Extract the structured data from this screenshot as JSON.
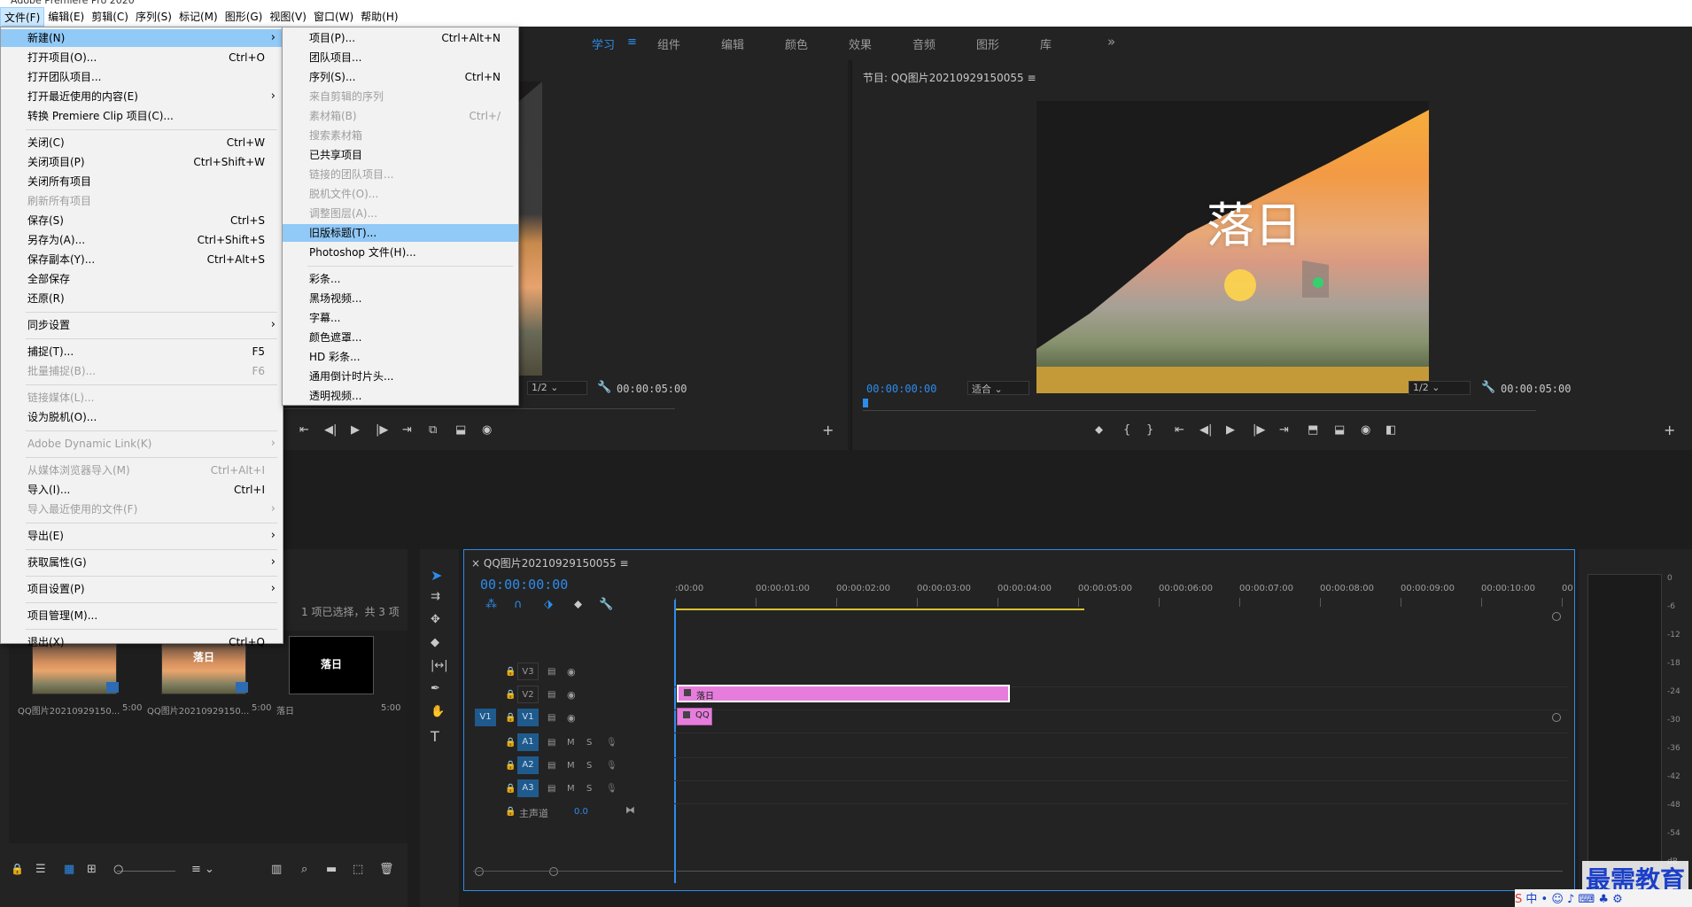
{
  "menubar": {
    "items": [
      "文件(F)",
      "编辑(E)",
      "剪辑(C)",
      "序列(S)",
      "标记(M)",
      "图形(G)",
      "视图(V)",
      "窗口(W)",
      "帮助(H)"
    ]
  },
  "workspaces": [
    "学习",
    "组件",
    "编辑",
    "颜色",
    "效果",
    "音频",
    "图形",
    "库"
  ],
  "workspace_more": "»",
  "file_menu": [
    {
      "label": "新建(N)",
      "shortcut": "",
      "sub": true,
      "state": "highlighted"
    },
    {
      "label": "打开项目(O)...",
      "shortcut": "Ctrl+O"
    },
    {
      "label": "打开团队项目..."
    },
    {
      "label": "打开最近使用的内容(E)",
      "sub": true
    },
    {
      "label": "转换 Premiere Clip 项目(C)..."
    },
    {
      "sep": true
    },
    {
      "label": "关闭(C)",
      "shortcut": "Ctrl+W"
    },
    {
      "label": "关闭项目(P)",
      "shortcut": "Ctrl+Shift+W"
    },
    {
      "label": "关闭所有项目"
    },
    {
      "label": "刷新所有项目",
      "state": "disabled"
    },
    {
      "label": "保存(S)",
      "shortcut": "Ctrl+S"
    },
    {
      "label": "另存为(A)...",
      "shortcut": "Ctrl+Shift+S"
    },
    {
      "label": "保存副本(Y)...",
      "shortcut": "Ctrl+Alt+S"
    },
    {
      "label": "全部保存"
    },
    {
      "label": "还原(R)"
    },
    {
      "sep": true
    },
    {
      "label": "同步设置",
      "sub": true
    },
    {
      "sep": true
    },
    {
      "label": "捕捉(T)...",
      "shortcut": "F5"
    },
    {
      "label": "批量捕捉(B)...",
      "shortcut": "F6",
      "state": "disabled"
    },
    {
      "sep": true
    },
    {
      "label": "链接媒体(L)...",
      "state": "disabled"
    },
    {
      "label": "设为脱机(O)..."
    },
    {
      "sep": true
    },
    {
      "label": "Adobe Dynamic Link(K)",
      "sub": true,
      "state": "disabled"
    },
    {
      "sep": true
    },
    {
      "label": "从媒体浏览器导入(M)",
      "shortcut": "Ctrl+Alt+I",
      "state": "disabled"
    },
    {
      "label": "导入(I)...",
      "shortcut": "Ctrl+I"
    },
    {
      "label": "导入最近使用的文件(F)",
      "sub": true,
      "state": "disabled"
    },
    {
      "sep": true
    },
    {
      "label": "导出(E)",
      "sub": true
    },
    {
      "sep": true
    },
    {
      "label": "获取属性(G)",
      "sub": true
    },
    {
      "sep": true
    },
    {
      "label": "项目设置(P)",
      "sub": true
    },
    {
      "sep": true
    },
    {
      "label": "项目管理(M)..."
    },
    {
      "sep": true
    },
    {
      "label": "退出(X)",
      "shortcut": "Ctrl+Q"
    }
  ],
  "new_submenu": [
    {
      "label": "项目(P)...",
      "shortcut": "Ctrl+Alt+N"
    },
    {
      "label": "团队项目..."
    },
    {
      "label": "序列(S)...",
      "shortcut": "Ctrl+N"
    },
    {
      "label": "来自剪辑的序列",
      "state": "disabled"
    },
    {
      "label": "素材箱(B)",
      "shortcut": "Ctrl+/",
      "state": "disabled"
    },
    {
      "label": "搜索素材箱",
      "state": "disabled"
    },
    {
      "label": "已共享项目"
    },
    {
      "label": "链接的团队项目...",
      "state": "disabled"
    },
    {
      "label": "脱机文件(O)...",
      "state": "disabled"
    },
    {
      "label": "调整图层(A)...",
      "state": "disabled"
    },
    {
      "label": "旧版标题(T)...",
      "state": "highlighted"
    },
    {
      "label": "Photoshop 文件(H)..."
    },
    {
      "sep": true
    },
    {
      "label": "彩条..."
    },
    {
      "label": "黑场视频..."
    },
    {
      "label": "字幕..."
    },
    {
      "label": "颜色遮罩..."
    },
    {
      "label": "HD 彩条..."
    },
    {
      "label": "通用倒计时片头..."
    },
    {
      "label": "透明视频..."
    }
  ],
  "source_monitor": {
    "zoom": "1/2",
    "duration": "00:00:05:00"
  },
  "program_monitor": {
    "title": "节目: QQ图片20210929150055",
    "timecode": "00:00:00:00",
    "fit": "适合",
    "zoom": "1/2",
    "duration": "00:00:05:00",
    "overlay_text": "落日"
  },
  "project_panel": {
    "selection": "1 项已选择，共 3 项",
    "items": [
      {
        "name": "QQ图片20210929150...",
        "duration": "5:00",
        "kind": "image"
      },
      {
        "name": "QQ图片20210929150...",
        "duration": "5:00",
        "kind": "sequence",
        "overlay": "落日"
      },
      {
        "name": "落日",
        "duration": "5:00",
        "kind": "title",
        "overlay": "落日"
      }
    ]
  },
  "timeline": {
    "tab": "QQ图片20210929150055",
    "timecode": "00:00:00:00",
    "ruler": [
      ":00:00",
      "00:00:01:00",
      "00:00:02:00",
      "00:00:03:00",
      "00:00:04:00",
      "00:00:05:00",
      "00:00:06:00",
      "00:00:07:00",
      "00:00:08:00",
      "00:00:09:00",
      "00:00:10:00",
      "00"
    ],
    "video_tracks": [
      "V3",
      "V2",
      "V1"
    ],
    "audio_tracks": [
      "A1",
      "A2",
      "A3"
    ],
    "source_patch": "V1",
    "mute": "M",
    "solo": "S",
    "master": "主声道",
    "master_value": "0.0",
    "clips": [
      {
        "track": "V2",
        "label": "落日",
        "color": "#e67ddc"
      },
      {
        "track": "V1",
        "label": "QQ",
        "color": "#e67ddc"
      }
    ]
  },
  "vu_scale": [
    "0",
    "-6",
    "-12",
    "-18",
    "-24",
    "-30",
    "-36",
    "-42",
    "-48",
    "-54",
    "dB"
  ],
  "watermark": "最需教育",
  "ime": "中"
}
